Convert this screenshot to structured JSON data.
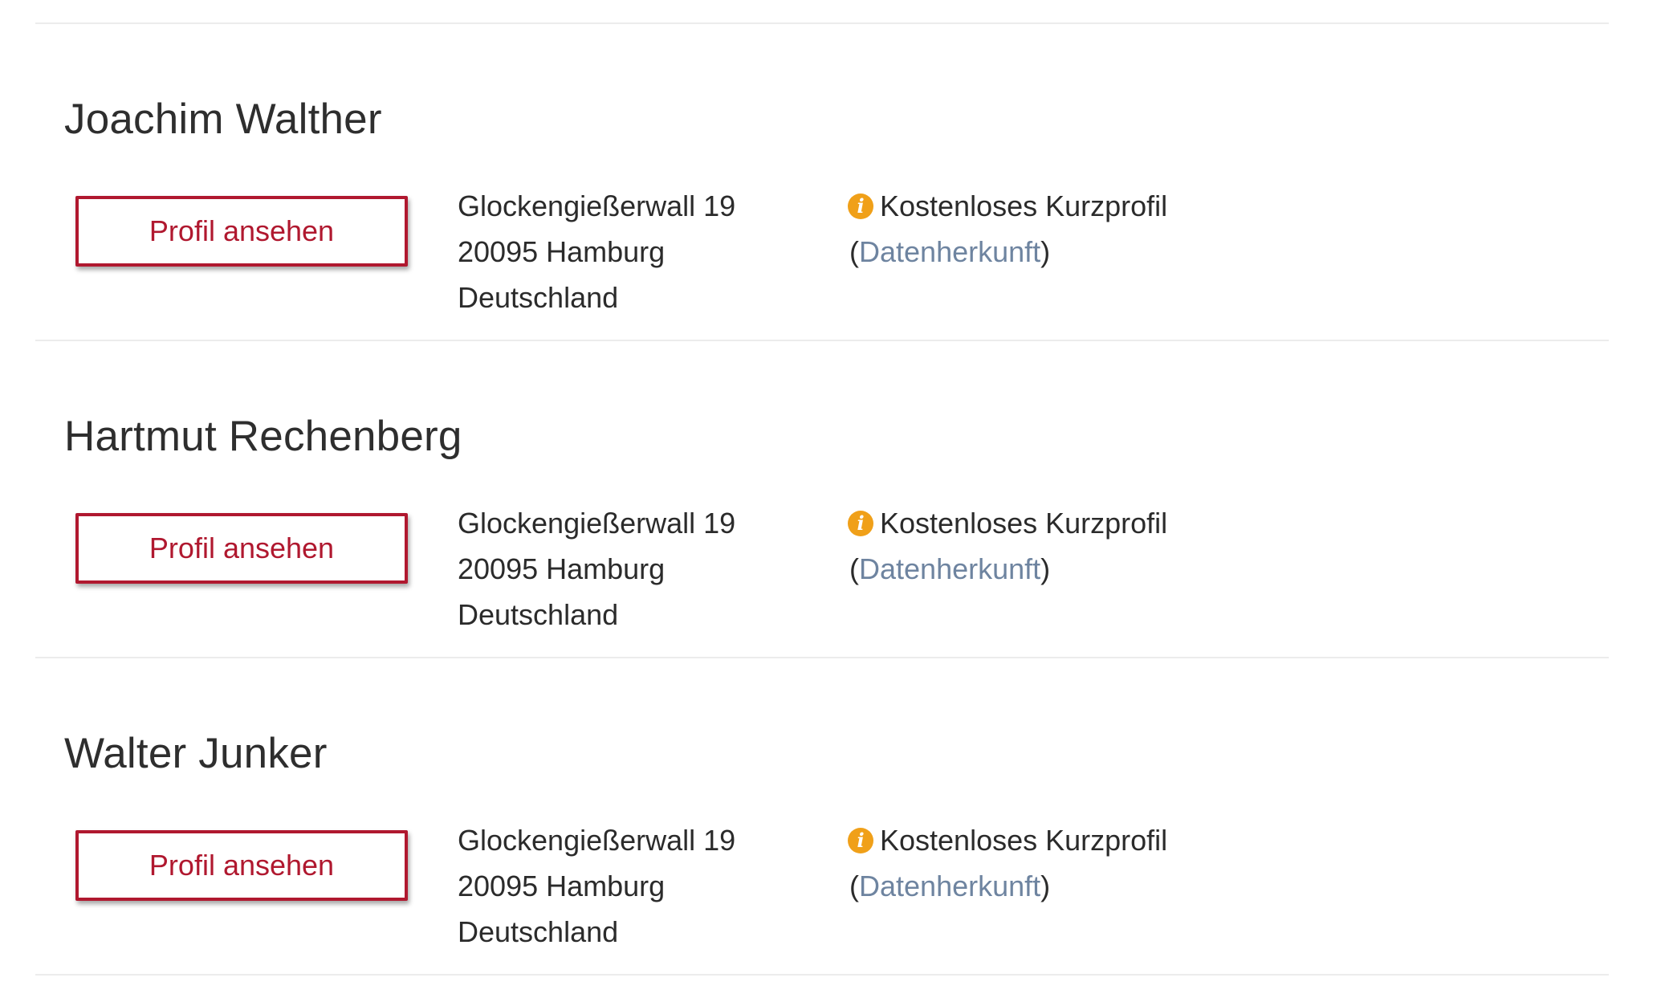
{
  "entries": [
    {
      "name": "Joachim Walther",
      "button_label": "Profil ansehen",
      "address": [
        "Glockengießerwall 19",
        "20095 Hamburg",
        "Deutschland"
      ],
      "info_label": "Kostenloses Kurzprofil",
      "paren_open": "(",
      "source_link": "Datenherkunft",
      "paren_close": ")"
    },
    {
      "name": "Hartmut Rechenberg",
      "button_label": "Profil ansehen",
      "address": [
        "Glockengießerwall 19",
        "20095 Hamburg",
        "Deutschland"
      ],
      "info_label": "Kostenloses Kurzprofil",
      "paren_open": "(",
      "source_link": "Datenherkunft",
      "paren_close": ")"
    },
    {
      "name": "Walter Junker",
      "button_label": "Profil ansehen",
      "address": [
        "Glockengießerwall 19",
        "20095 Hamburg",
        "Deutschland"
      ],
      "info_label": "Kostenloses Kurzprofil",
      "paren_open": "(",
      "source_link": "Datenherkunft",
      "paren_close": ")"
    }
  ],
  "icons": {
    "info": "info-circle-icon",
    "info_glyph": "i"
  },
  "colors": {
    "accent": "#b0182f",
    "info_icon": "#f0a019",
    "link": "#6e84a0",
    "text": "#2b2b2b",
    "divider": "#ececec"
  }
}
